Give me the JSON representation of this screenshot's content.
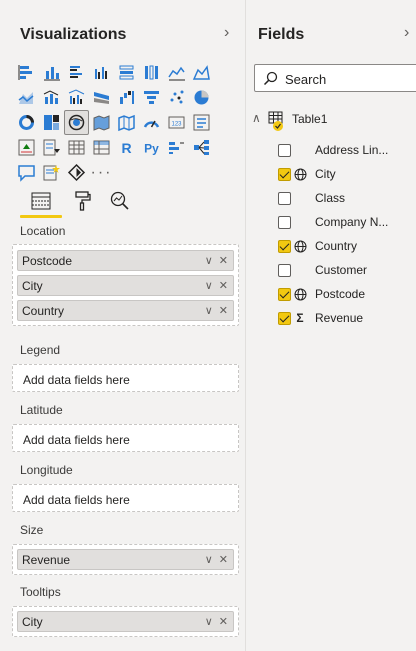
{
  "visualizations": {
    "title": "Visualizations",
    "more_label": "···"
  },
  "fields": {
    "title": "Fields",
    "search_placeholder": "Search",
    "table_name": "Table1",
    "items": [
      {
        "label": "Address Lin...",
        "checked": false,
        "type": ""
      },
      {
        "label": "City",
        "checked": true,
        "type": "geo"
      },
      {
        "label": "Class",
        "checked": false,
        "type": ""
      },
      {
        "label": "Company N...",
        "checked": false,
        "type": ""
      },
      {
        "label": "Country",
        "checked": true,
        "type": "geo"
      },
      {
        "label": "Customer",
        "checked": false,
        "type": ""
      },
      {
        "label": "Postcode",
        "checked": true,
        "type": "geo"
      },
      {
        "label": "Revenue",
        "checked": true,
        "type": "sigma"
      }
    ]
  },
  "wells": {
    "location": {
      "label": "Location",
      "items": [
        "Postcode",
        "City",
        "Country"
      ]
    },
    "legend": {
      "label": "Legend",
      "placeholder": "Add data fields here"
    },
    "latitude": {
      "label": "Latitude",
      "placeholder": "Add data fields here"
    },
    "longitude": {
      "label": "Longitude",
      "placeholder": "Add data fields here"
    },
    "size": {
      "label": "Size",
      "items": [
        "Revenue"
      ]
    },
    "tooltips": {
      "label": "Tooltips",
      "items": [
        "City"
      ]
    }
  },
  "colors": {
    "accent_yellow": "#f2c811",
    "viz_blue": "#2b7cd3",
    "viz_teal": "#118dff"
  }
}
